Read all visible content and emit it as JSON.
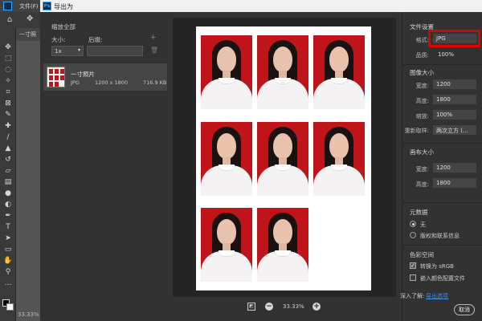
{
  "app": {
    "menu": {
      "file_label": "文件(F)"
    },
    "doc_tab": "一寸照",
    "zoom_status": "33.33%"
  },
  "dialog": {
    "title": "导出为",
    "left": {
      "scale_all_title": "缩放全部",
      "size_label": "大小:",
      "suffix_label": "后缀:",
      "scale_value": "1x",
      "suffix_value": "",
      "add_icon": "plus-icon",
      "delete_icon": "trash-icon",
      "asset": {
        "name": "一寸照片",
        "format": "JPG",
        "dimensions": "1200 x 1800",
        "size": "716.9 KB"
      }
    },
    "preview": {
      "zoom": "33.33%",
      "photo_count": 8
    },
    "right": {
      "file_settings_title": "文件设置",
      "format_label": "格式:",
      "format_value": "JPG",
      "quality_label": "品质:",
      "quality_value": "100%",
      "image_size_title": "图像大小",
      "width_label": "宽度:",
      "width_value": "1200",
      "height_label": "高度:",
      "height_value": "1800",
      "scale_label": "缩放:",
      "scale_value": "100%",
      "resample_label": "重新取样:",
      "resample_value": "两次立方 (...",
      "canvas_size_title": "画布大小",
      "canvas_width_label": "宽度:",
      "canvas_width_value": "1200",
      "canvas_height_label": "高度:",
      "canvas_height_value": "1800",
      "metadata_title": "元数据",
      "meta_none": "无",
      "meta_copyright": "版权和联系信息",
      "color_space_title": "色彩空间",
      "convert_srgb": "转换为 sRGB",
      "embed_profile": "嵌入颜色配置文件",
      "learn_more_text": "深入了解:",
      "learn_more_link": "导出选项",
      "cancel_label": "取消"
    }
  },
  "colors": {
    "highlight": "#e00000",
    "photo_bg": "#c0141b",
    "link": "#3d8fe0"
  }
}
